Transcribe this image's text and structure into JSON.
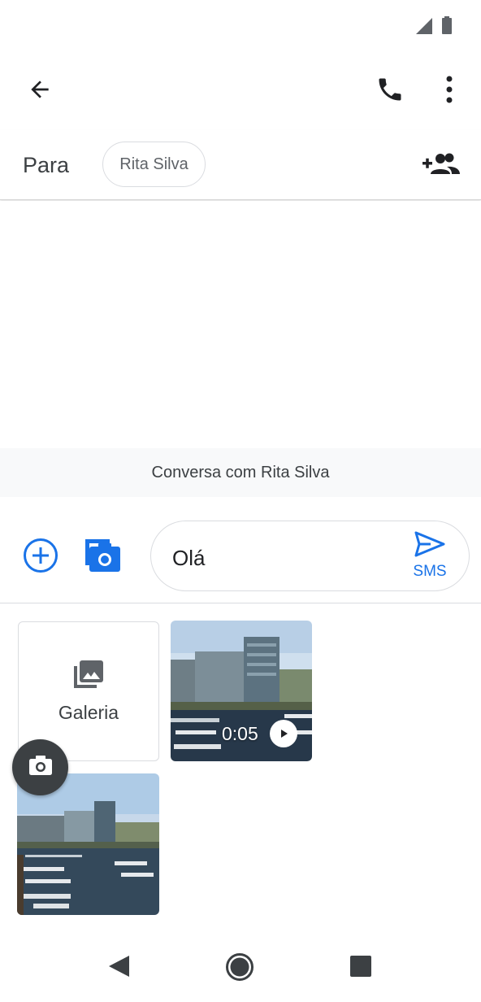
{
  "status_bar": {
    "icons": [
      "signal-icon",
      "battery-icon"
    ]
  },
  "app_bar": {
    "icons": [
      "back-arrow-icon",
      "phone-icon",
      "more-vert-icon"
    ]
  },
  "recipient": {
    "label": "Para",
    "chip": "Rita Silva",
    "add_icon": "add-people-icon"
  },
  "conversation": {
    "banner": "Conversa com Rita Silva"
  },
  "compose": {
    "text": "Olá",
    "send_label": "SMS",
    "icons": [
      "add-circle-icon",
      "camera-gallery-icon",
      "send-icon"
    ]
  },
  "attachments": {
    "gallery_label": "Galeria",
    "video_duration": "0:05",
    "icons": [
      "image-stack-icon",
      "play-icon",
      "camera-icon"
    ]
  },
  "nav_bar": {
    "icons": [
      "nav-back-icon",
      "nav-home-icon",
      "nav-recent-icon"
    ]
  },
  "colors": {
    "accent": "#1a73e8",
    "text": "#202124",
    "secondary": "#5f6368",
    "banner_bg": "#f8f9fa"
  }
}
